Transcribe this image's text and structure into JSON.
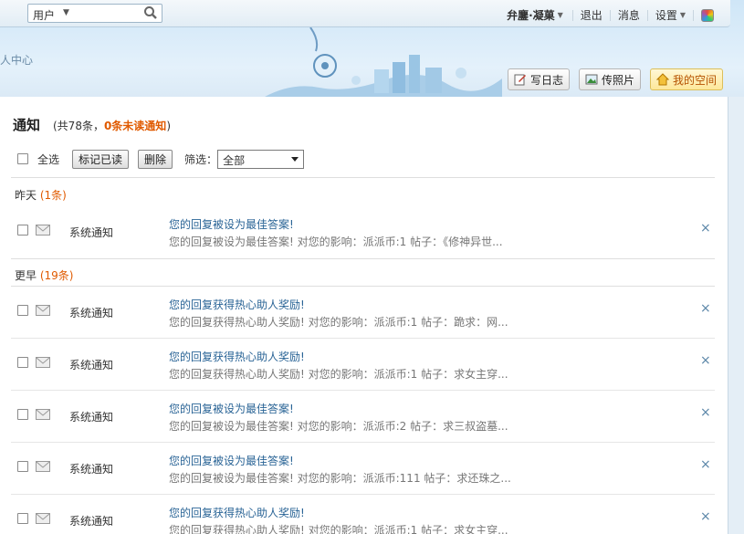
{
  "topbar": {
    "search_scope": "用户",
    "username": "弁鏖·凝菓",
    "logout": "退出",
    "messages": "消息",
    "settings": "设置"
  },
  "header": {
    "breadcrumb": "人中心",
    "write_log": "写日志",
    "upload_photo": "传照片",
    "my_space": "我的空间"
  },
  "page": {
    "title": "通知",
    "total": "(共78条，",
    "unread": "0条未读通知",
    "close_paren": ")"
  },
  "toolbar": {
    "select_all": "全选",
    "mark_read": "标记已读",
    "delete": "删除",
    "filter_label": "筛选：",
    "filter_value": "全部"
  },
  "groups": [
    {
      "label": "昨天",
      "count": "(1条)"
    },
    {
      "label": "更早",
      "count": "(19条)"
    }
  ],
  "notifications": [
    {
      "type": "系统通知",
      "title": "您的回复被设为最佳答案!",
      "desc": "您的回复被设为最佳答案! 对您的影响：派派币:1 帖子：《修神异世..."
    },
    {
      "type": "系统通知",
      "title": "您的回复获得热心助人奖励!",
      "desc": "您的回复获得热心助人奖励! 对您的影响：派派币:1 帖子：跪求：网..."
    },
    {
      "type": "系统通知",
      "title": "您的回复获得热心助人奖励!",
      "desc": "您的回复获得热心助人奖励! 对您的影响：派派币:1 帖子：求女主穿..."
    },
    {
      "type": "系统通知",
      "title": "您的回复被设为最佳答案!",
      "desc": "您的回复被设为最佳答案! 对您的影响：派派币:2 帖子：求三叔盗墓..."
    },
    {
      "type": "系统通知",
      "title": "您的回复被设为最佳答案!",
      "desc": "您的回复被设为最佳答案! 对您的影响：派派币:111 帖子：求还珠之..."
    },
    {
      "type": "系统通知",
      "title": "您的回复获得热心助人奖励!",
      "desc": "您的回复获得热心助人奖励! 对您的影响：派派币:1 帖子：求女主穿..."
    }
  ],
  "icons": {
    "search": "magnifier-icon",
    "mail": "envelope-icon",
    "close": "close-icon",
    "app": "color-wheel-icon"
  }
}
